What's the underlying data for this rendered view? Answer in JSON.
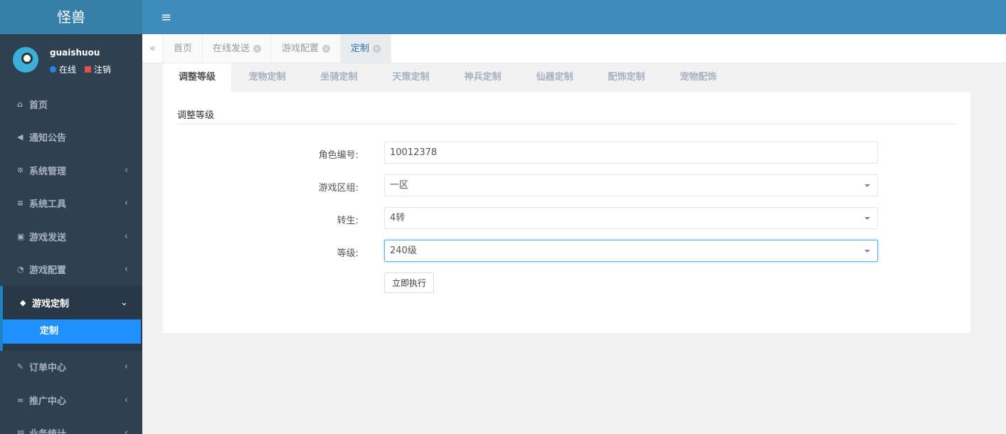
{
  "app": {
    "logo": "怪兽"
  },
  "user": {
    "name": "guaishuou",
    "status": "在线",
    "logout": "注销"
  },
  "sidebar": {
    "items": [
      {
        "label": "首页",
        "icon": "home-icon"
      },
      {
        "label": "通知公告",
        "icon": "bullhorn-icon"
      },
      {
        "label": "系统管理",
        "icon": "gear-icon"
      },
      {
        "label": "系统工具",
        "icon": "bars-icon"
      },
      {
        "label": "游戏发送",
        "icon": "gift-icon"
      },
      {
        "label": "游戏配置",
        "icon": "dashboard-icon"
      },
      {
        "label": "游戏定制",
        "icon": "cube-icon",
        "open": true,
        "children": [
          {
            "label": "定制",
            "active": true
          }
        ]
      },
      {
        "label": "订单中心",
        "icon": "brush-icon"
      },
      {
        "label": "推广中心",
        "icon": "handshake-icon"
      },
      {
        "label": "业务统计",
        "icon": "chart-icon"
      }
    ]
  },
  "tabs": [
    {
      "label": "首页"
    },
    {
      "label": "在线发送"
    },
    {
      "label": "游戏配置"
    },
    {
      "label": "定制",
      "active": true
    }
  ],
  "subtabs": [
    "调整等级",
    "宠物定制",
    "坐骑定制",
    "天策定制",
    "神兵定制",
    "仙器定制",
    "配饰定制",
    "宠物配饰"
  ],
  "form": {
    "title": "调整等级",
    "role_label": "角色编号:",
    "role_value": "10012378",
    "zone_label": "游戏区组:",
    "zone_value": "一区",
    "rebirth_label": "转生:",
    "rebirth_value": "4转",
    "level_label": "等级:",
    "level_value": "240级",
    "submit": "立即执行"
  }
}
